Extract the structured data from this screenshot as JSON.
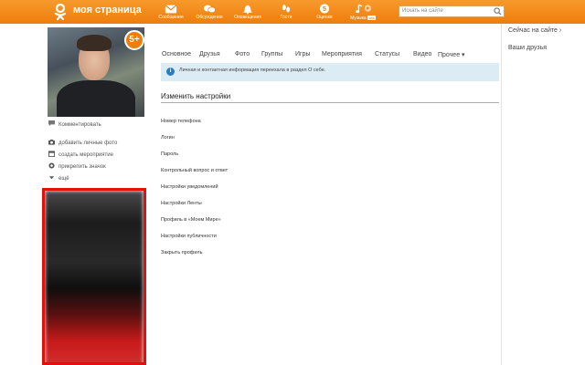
{
  "topbar": {
    "brand": "моя страница",
    "nav": [
      {
        "label": "Сообщения",
        "icon": "envelope-icon"
      },
      {
        "label": "Обсуждения",
        "icon": "speech-bubbles-icon"
      },
      {
        "label": "Оповещения",
        "icon": "bell-icon"
      },
      {
        "label": "Гости",
        "icon": "footprints-icon"
      },
      {
        "label": "Оценки",
        "icon": "rating-icon",
        "glyph": "5"
      },
      {
        "label": "Музыка",
        "icon": "music-note-icon",
        "badge": "new"
      }
    ],
    "search_placeholder": "Искать на сайте"
  },
  "profile": {
    "rating_badge": "5+",
    "comment_link": "Комментировать",
    "actions": [
      {
        "label": "добавить личные фото",
        "icon": "camera-icon"
      },
      {
        "label": "создать мероприятие",
        "icon": "calendar-icon"
      },
      {
        "label": "прикрепить значок",
        "icon": "badge-icon"
      },
      {
        "label": "ещё",
        "icon": "chevron-down-icon"
      }
    ]
  },
  "tabs": [
    {
      "label": "Основное"
    },
    {
      "label": "Друзья"
    },
    {
      "label": "Фото"
    },
    {
      "label": "Группы"
    },
    {
      "label": "Игры"
    },
    {
      "label": "Мероприятия"
    },
    {
      "label": "Статусы"
    },
    {
      "label": "Видео"
    },
    {
      "label": "Прочее ▾"
    }
  ],
  "info_message": "Личная и контактная информация переехала в раздел О себе.",
  "settings": {
    "title": "Изменить настройки",
    "items": [
      "Номер телефона",
      "Логин",
      "Пароль",
      "Контрольный вопрос и ответ",
      "Настройки уведомлений",
      "Настройки Ленты",
      "Профиль в «Моем Мире»",
      "Настройки публичности",
      "Закрыть профиль"
    ]
  },
  "right": {
    "online_now": "Сейчас на сайте ›",
    "your_friends": "Ваши друзья"
  },
  "colors": {
    "brand_orange": "#ee7d0b",
    "info_bg": "#dcecf4",
    "ad_border": "#e01010"
  }
}
